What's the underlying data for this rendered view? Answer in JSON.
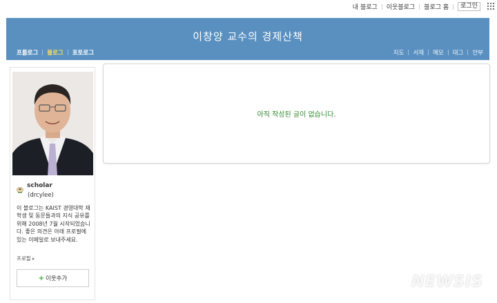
{
  "gnb": {
    "links": [
      "내 블로그",
      "이웃블로그",
      "블로그 홈"
    ],
    "login_label": "로그인"
  },
  "blog": {
    "title": "이창양 교수의 경제산책",
    "menu_left": [
      "프롤로그",
      "블로그",
      "포토로그"
    ],
    "active_menu": "블로그",
    "menu_right": [
      "지도",
      "서재",
      "메모",
      "태그",
      "안부"
    ],
    "header_color": "#5a90c0",
    "active_menu_color": "#f2e25c"
  },
  "profile": {
    "name": "scholar",
    "id": "(drcylee)",
    "description": "이 블로그는 KAIST 경영대학 재학생 및 동문들과의 지식 공유를 위해 2008년 7월 시작되었습니다. 좋은 의견은 아래 프로필에 있는 이메일로 보내주세요.",
    "profile_link": "프로필",
    "add_neighbor_label": "이웃추가"
  },
  "main": {
    "empty_message": "아직 작성된 글이 없습니다.",
    "message_color": "#2f8a2f"
  },
  "watermark": "NEWSIS"
}
